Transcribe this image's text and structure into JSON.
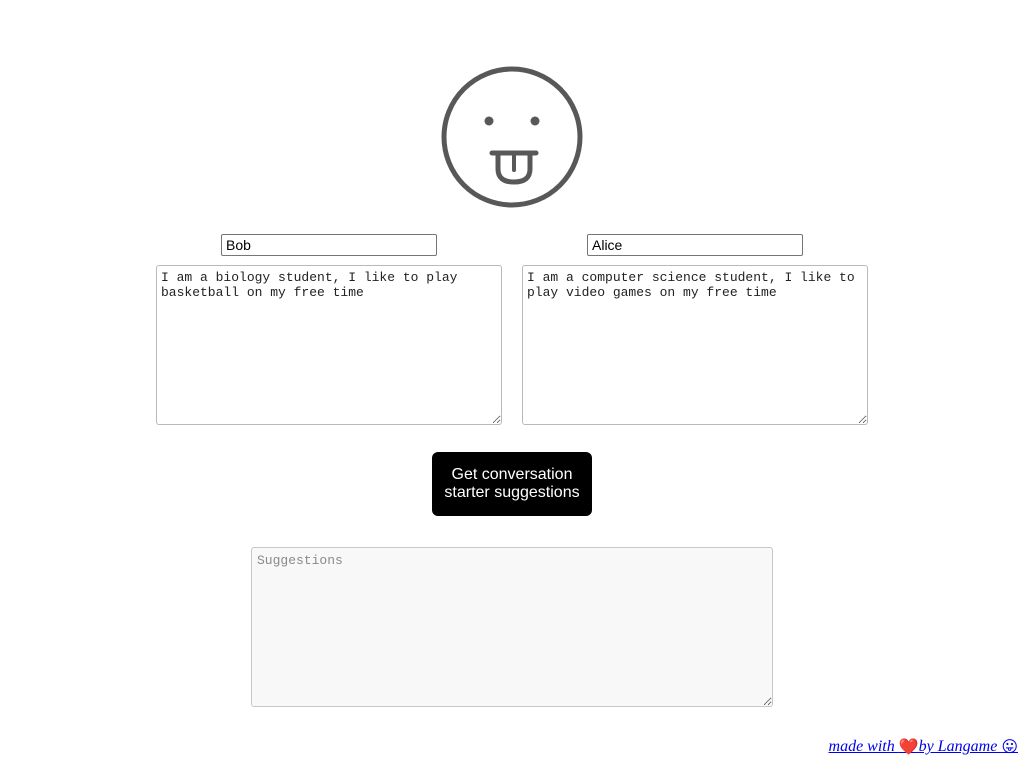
{
  "logo": {
    "icon": "tongue-out-face-icon",
    "stroke_color": "#58585b"
  },
  "people": [
    {
      "name": "Bob",
      "bio": "I am a biology student, I like to play basketball on my free time"
    },
    {
      "name": "Alice",
      "bio": "I am a computer science student, I like to play video games on my free time"
    }
  ],
  "action": {
    "label": "Get conversation starter suggestions"
  },
  "suggestions": {
    "value": "",
    "placeholder": "Suggestions"
  },
  "footer": {
    "prefix": "made with ",
    "heart": "❤️",
    "suffix": "by Langame ",
    "face": "😛"
  },
  "colors": {
    "button_bg": "#000000",
    "button_text": "#ffffff",
    "link": "#0000ee",
    "suggestions_bg": "#f8f8f8"
  }
}
